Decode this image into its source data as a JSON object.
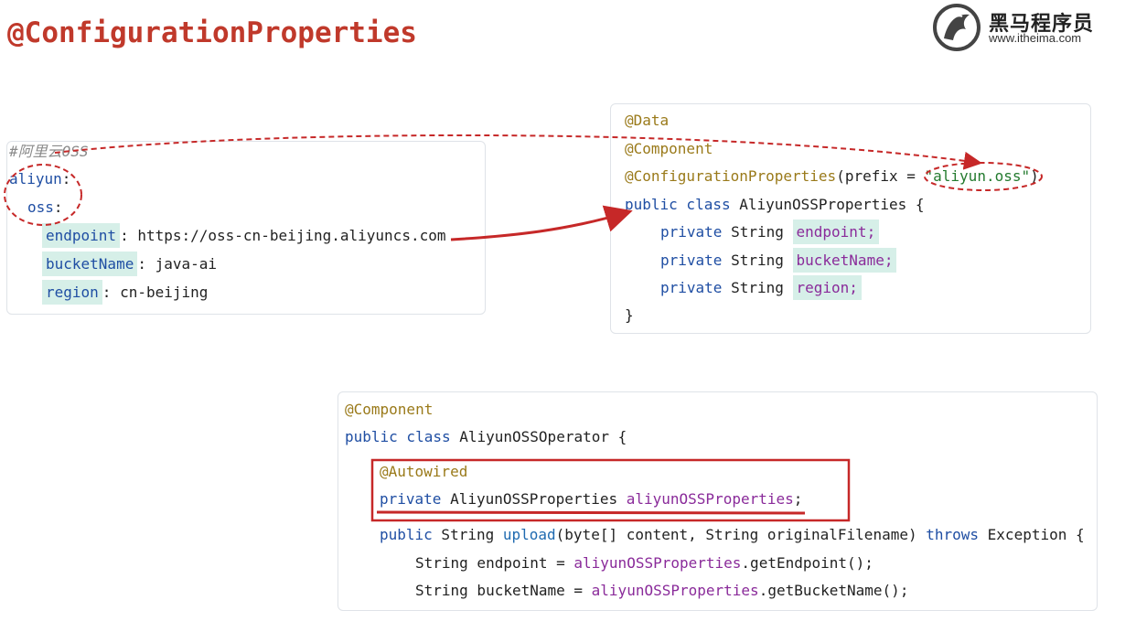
{
  "slide": {
    "title": "@ConfigurationProperties"
  },
  "logo": {
    "name_cn": "黑马程序员",
    "url": "www.itheima.com"
  },
  "yaml": {
    "comment": "#阿里云OSS",
    "root_key": "aliyun",
    "sub_key": "oss",
    "entries": [
      {
        "key": "endpoint",
        "value": "https://oss-cn-beijing.aliyuncs.com"
      },
      {
        "key": "bucketName",
        "value": "java-ai"
      },
      {
        "key": "region",
        "value": "cn-beijing"
      }
    ]
  },
  "properties_class": {
    "annotation_data": "@Data",
    "annotation_component": "@Component",
    "annotation_config": "@ConfigurationProperties",
    "prefix_arg": "(prefix = ",
    "prefix_value": "\"aliyun.oss\"",
    "prefix_close": ")",
    "decl_kw": "public class",
    "decl_name": " AliyunOSSProperties {",
    "fields": [
      {
        "modifier": "private",
        "type": " String ",
        "name": "endpoint;"
      },
      {
        "modifier": "private",
        "type": " String ",
        "name": "bucketName;"
      },
      {
        "modifier": "private",
        "type": " String ",
        "name": "region;"
      }
    ],
    "close": "}"
  },
  "operator_class": {
    "annotation_component": "@Component",
    "decl_kw": "public class",
    "decl_name": " AliyunOSSOperator {",
    "autowired": "@Autowired",
    "field_kw": "private",
    "field_type": " AliyunOSSProperties ",
    "field_name": "aliyunOSSProperties",
    "field_end": ";",
    "method_kw": "public",
    "method_type": " String ",
    "method_name": "upload",
    "method_params_a": "(byte[] content, String originalFilename) ",
    "method_throws": "throws",
    "method_exc": " Exception {",
    "body": [
      {
        "lhs": "String endpoint = ",
        "obj": "aliyunOSSProperties",
        "call": ".getEndpoint();"
      },
      {
        "lhs": "String bucketName = ",
        "obj": "aliyunOSSProperties",
        "call": ".getBucketName();"
      }
    ]
  },
  "colors": {
    "title": "#c0392b",
    "annotation_marker": "#c62828",
    "highlight_bg": "#d6efe8"
  }
}
